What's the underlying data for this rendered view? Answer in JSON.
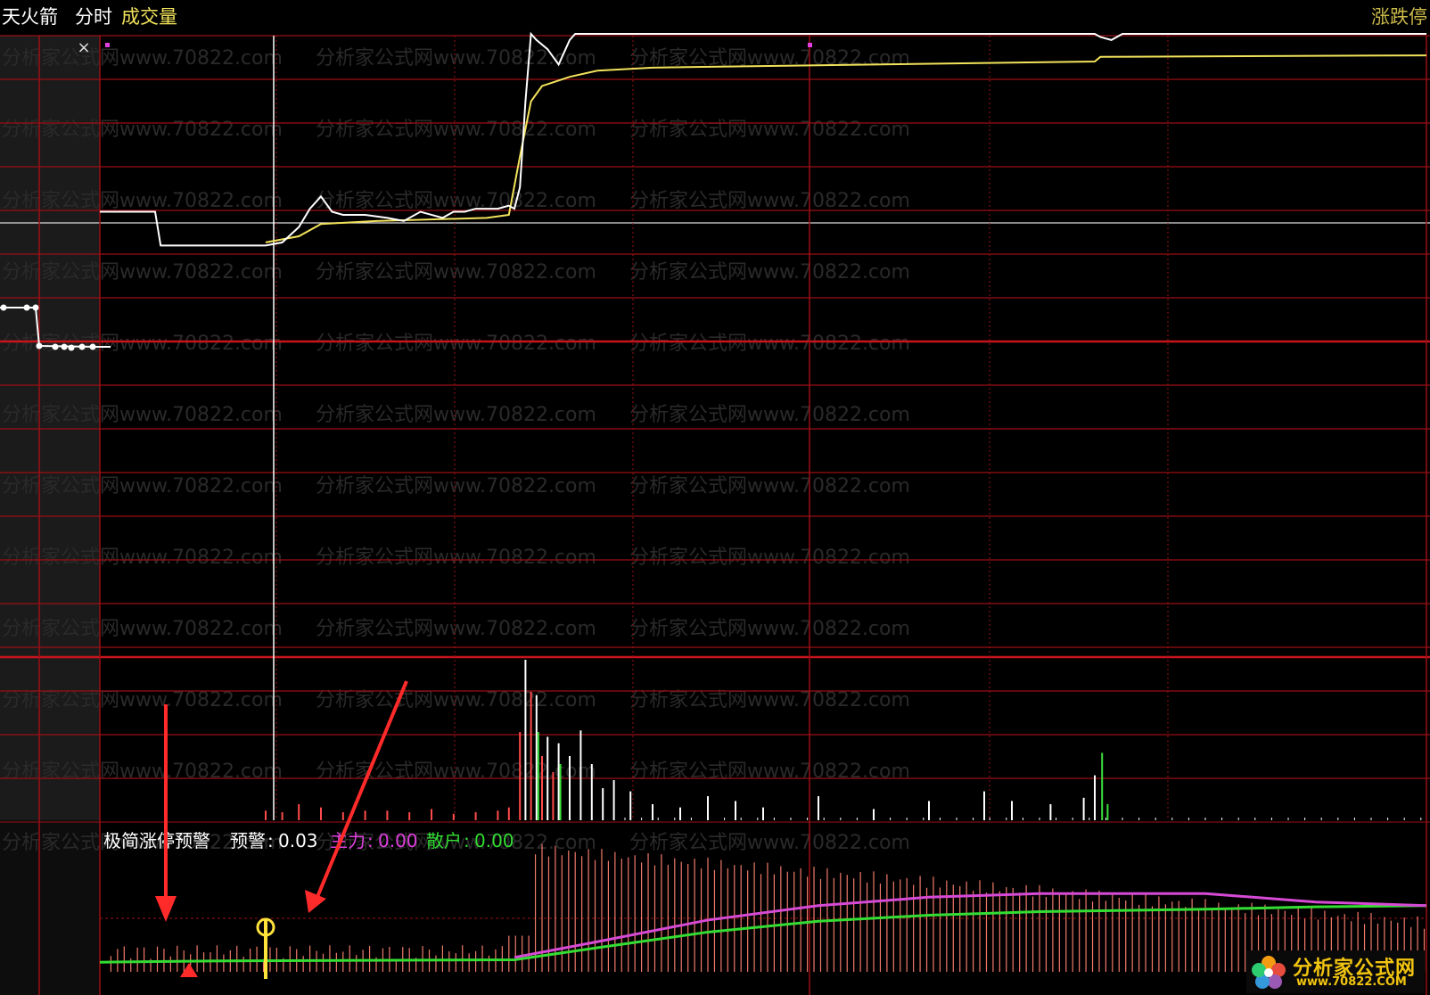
{
  "header": {
    "label_main": "天火箭",
    "label_mode": "分时",
    "label_volume": "成交量",
    "label_right": "涨跌停"
  },
  "indicator": {
    "name": "极简涨停预警",
    "warn_label": "预警",
    "warn_value": "0.03",
    "main_label": "主力",
    "main_value": "0.00",
    "retail_label": "散户",
    "retail_value": "0.00"
  },
  "watermark": "分析家公式网www.70822.com",
  "logo": {
    "name": "分析家公式网",
    "url": "www.70822.COM"
  },
  "close_symbol": "×",
  "colors": {
    "grid": "#9b0f14",
    "grid_bold": "#c8141c",
    "price": "#ffffff",
    "avg": "#f2e35b",
    "volume": "#ffffff",
    "volume_up": "#ff4b4b",
    "volume_down": "#39e039",
    "ind_bars": "#f27a6b",
    "main_line": "#d64ad6",
    "retail_line": "#33dd33",
    "marker": "#ffe23a"
  },
  "chart_data": [
    {
      "type": "line",
      "name": "intraday-price",
      "x_range": [
        0,
        240
      ],
      "y_range": [
        0,
        1
      ],
      "series": [
        {
          "name": "price",
          "points": [
            [
              0,
              0.42
            ],
            [
              10,
              0.42
            ],
            [
              11,
              0.31
            ],
            [
              18,
              0.31
            ],
            [
              25,
              0.31
            ],
            [
              30,
              0.31
            ],
            [
              33,
              0.32
            ],
            [
              36,
              0.37
            ],
            [
              38,
              0.43
            ],
            [
              40,
              0.47
            ],
            [
              42,
              0.42
            ],
            [
              44,
              0.41
            ],
            [
              48,
              0.41
            ],
            [
              52,
              0.4
            ],
            [
              55,
              0.39
            ],
            [
              58,
              0.42
            ],
            [
              60,
              0.41
            ],
            [
              62,
              0.4
            ],
            [
              64,
              0.42
            ],
            [
              66,
              0.42
            ],
            [
              68,
              0.43
            ],
            [
              70,
              0.43
            ],
            [
              72,
              0.43
            ],
            [
              74,
              0.44
            ],
            [
              75,
              0.43
            ],
            [
              76,
              0.5
            ],
            [
              77,
              0.78
            ],
            [
              78,
              1.0
            ],
            [
              79,
              0.98
            ],
            [
              81,
              0.95
            ],
            [
              83,
              0.9
            ],
            [
              85,
              0.98
            ],
            [
              86,
              1.0
            ],
            [
              180,
              1.0
            ],
            [
              181,
              0.99
            ],
            [
              183,
              0.98
            ],
            [
              185,
              1.0
            ],
            [
              240,
              1.0
            ]
          ]
        },
        {
          "name": "avg",
          "points": [
            [
              30,
              0.32
            ],
            [
              36,
              0.34
            ],
            [
              40,
              0.38
            ],
            [
              50,
              0.39
            ],
            [
              70,
              0.4
            ],
            [
              74,
              0.41
            ],
            [
              76,
              0.6
            ],
            [
              78,
              0.78
            ],
            [
              80,
              0.83
            ],
            [
              85,
              0.86
            ],
            [
              90,
              0.88
            ],
            [
              100,
              0.89
            ],
            [
              140,
              0.9
            ],
            [
              180,
              0.91
            ],
            [
              181,
              0.925
            ],
            [
              240,
              0.93
            ]
          ]
        }
      ]
    },
    {
      "type": "bar",
      "name": "volume",
      "notes": "relative heights 0..1 per minute bucket",
      "values_up": [
        [
          30,
          0.06
        ],
        [
          33,
          0.05
        ],
        [
          36,
          0.1
        ],
        [
          40,
          0.08
        ],
        [
          44,
          0.05
        ],
        [
          48,
          0.06
        ],
        [
          52,
          0.06
        ],
        [
          56,
          0.05
        ],
        [
          60,
          0.07
        ],
        [
          64,
          0.04
        ],
        [
          68,
          0.05
        ],
        [
          72,
          0.06
        ],
        [
          74,
          0.08
        ],
        [
          76,
          0.55
        ],
        [
          78,
          0.8
        ],
        [
          80,
          0.4
        ],
        [
          82,
          0.3
        ]
      ],
      "values_white": [
        [
          77,
          1.0
        ],
        [
          79,
          0.78
        ],
        [
          81,
          0.52
        ],
        [
          83,
          0.48
        ],
        [
          85,
          0.4
        ],
        [
          87,
          0.56
        ],
        [
          89,
          0.35
        ],
        [
          91,
          0.2
        ],
        [
          93,
          0.25
        ],
        [
          96,
          0.18
        ],
        [
          100,
          0.1
        ],
        [
          105,
          0.08
        ],
        [
          110,
          0.15
        ],
        [
          115,
          0.12
        ],
        [
          120,
          0.08
        ],
        [
          130,
          0.15
        ],
        [
          140,
          0.07
        ],
        [
          150,
          0.12
        ],
        [
          160,
          0.18
        ],
        [
          165,
          0.12
        ],
        [
          172,
          0.1
        ],
        [
          178,
          0.14
        ],
        [
          180,
          0.28
        ]
      ],
      "values_down": [
        [
          79,
          0.55
        ],
        [
          83,
          0.35
        ],
        [
          181,
          0.42
        ],
        [
          182,
          0.1
        ]
      ]
    },
    {
      "type": "area",
      "name": "indicator",
      "series": [
        {
          "name": "bars",
          "desc": "dense red vertical bars; small before breakout, then tall and slowly tapering"
        },
        {
          "name": "main",
          "points": [
            [
              75,
              0.12
            ],
            [
              90,
              0.25
            ],
            [
              110,
              0.43
            ],
            [
              130,
              0.55
            ],
            [
              150,
              0.62
            ],
            [
              170,
              0.65
            ],
            [
              200,
              0.65
            ],
            [
              220,
              0.58
            ],
            [
              240,
              0.55
            ]
          ]
        },
        {
          "name": "retail",
          "points": [
            [
              0,
              0.08
            ],
            [
              20,
              0.09
            ],
            [
              75,
              0.1
            ],
            [
              90,
              0.2
            ],
            [
              110,
              0.33
            ],
            [
              130,
              0.42
            ],
            [
              150,
              0.47
            ],
            [
              170,
              0.5
            ],
            [
              200,
              0.52
            ],
            [
              220,
              0.54
            ],
            [
              240,
              0.55
            ]
          ]
        }
      ],
      "ref_line": 0.53
    }
  ]
}
